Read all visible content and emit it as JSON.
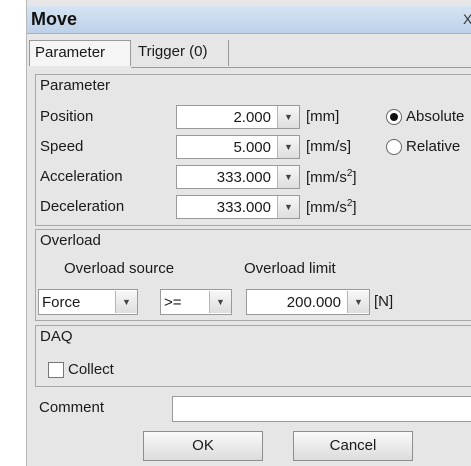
{
  "window": {
    "title": "Move",
    "close_glyph": "X"
  },
  "tabs": [
    {
      "label": "Parameter"
    },
    {
      "label": "Trigger (0)"
    }
  ],
  "parameter": {
    "section_title": "Parameter",
    "rows": [
      {
        "label": "Position",
        "value": "2.000",
        "unit": "[mm]",
        "unit_sup": ""
      },
      {
        "label": "Speed",
        "value": "5.000",
        "unit": "[mm/s]",
        "unit_sup": ""
      },
      {
        "label": "Acceleration",
        "value": "333.000",
        "unit": "[mm/s",
        "unit_sup": "2",
        "unit_close": "]"
      },
      {
        "label": "Deceleration",
        "value": "333.000",
        "unit": "[mm/s",
        "unit_sup": "2",
        "unit_close": "]"
      }
    ],
    "mode": {
      "options": [
        "Absolute",
        "Relative"
      ],
      "selected": "Absolute"
    }
  },
  "overload": {
    "section_title": "Overload",
    "source_label": "Overload source",
    "limit_label": "Overload limit",
    "source_value": "Force",
    "operator_value": ">=",
    "limit_value": "200.000",
    "limit_unit": "[N]"
  },
  "daq": {
    "section_title": "DAQ",
    "collect_label": "Collect",
    "collect_checked": false
  },
  "comment": {
    "label": "Comment",
    "value": ""
  },
  "buttons": {
    "ok": "OK",
    "cancel": "Cancel"
  },
  "icons": {
    "dropdown": "chevron-down-icon",
    "close": "close-icon"
  }
}
